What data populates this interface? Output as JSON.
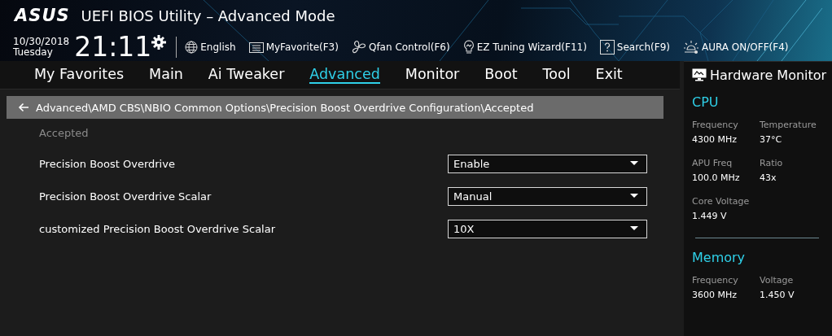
{
  "header": {
    "logo": "ASUS",
    "title": "UEFI BIOS Utility – Advanced Mode",
    "date": "10/30/2018",
    "day": "Tuesday",
    "time": "21:11",
    "tools": [
      {
        "kind": "language",
        "label": "English"
      },
      {
        "kind": "favorite",
        "label": "MyFavorite(F3)"
      },
      {
        "kind": "fan",
        "label": "Qfan Control(F6)"
      },
      {
        "kind": "wizard",
        "label": "EZ Tuning Wizard(F11)"
      },
      {
        "kind": "search",
        "label": "Search(F9)"
      },
      {
        "kind": "aura",
        "label": "AURA ON/OFF(F4)"
      }
    ]
  },
  "tabs": [
    {
      "label": "My Favorites",
      "selected": false
    },
    {
      "label": "Main",
      "selected": false
    },
    {
      "label": "Ai Tweaker",
      "selected": false
    },
    {
      "label": "Advanced",
      "selected": true
    },
    {
      "label": "Monitor",
      "selected": false
    },
    {
      "label": "Boot",
      "selected": false
    },
    {
      "label": "Tool",
      "selected": false
    },
    {
      "label": "Exit",
      "selected": false
    }
  ],
  "breadcrumb": "Advanced\\AMD CBS\\NBIO Common Options\\Precision Boost Overdrive Configuration\\Accepted",
  "section_label": "Accepted",
  "settings": [
    {
      "label": "Precision Boost Overdrive",
      "value": "Enable"
    },
    {
      "label": "Precision Boost Overdrive Scalar",
      "value": "Manual"
    },
    {
      "label": "customized Precision Boost Overdrive Scalar",
      "value": "10X"
    }
  ],
  "hardware_monitor": {
    "title": "Hardware Monitor",
    "sections": [
      {
        "title": "CPU",
        "readings": [
          {
            "label": "Frequency",
            "value": "4300 MHz"
          },
          {
            "label": "Temperature",
            "value": "37°C"
          },
          {
            "label": "APU Freq",
            "value": "100.0 MHz"
          },
          {
            "label": "Ratio",
            "value": "43x"
          },
          {
            "label": "Core Voltage",
            "value": "1.449 V"
          }
        ]
      },
      {
        "title": "Memory",
        "readings": [
          {
            "label": "Frequency",
            "value": "3600 MHz"
          },
          {
            "label": "Voltage",
            "value": "1.450 V"
          }
        ]
      }
    ]
  }
}
